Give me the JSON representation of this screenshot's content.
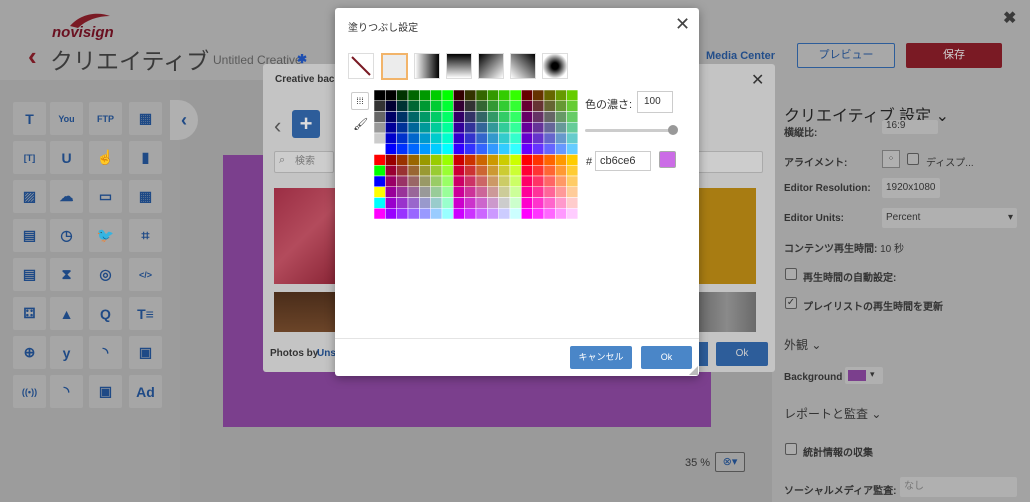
{
  "header": {
    "logo_text": "novisign",
    "title": "クリエイティブ",
    "creative_name": "Untitled Creative",
    "unsaved_marker": "✱",
    "media_center": "Media Center",
    "preview_label": "プレビュー",
    "save_label": "保存"
  },
  "toolbar": {
    "collapse_icon": "chevron-left-icon",
    "tools": [
      {
        "icon": "text-icon",
        "glyph": "T"
      },
      {
        "icon": "youtube-icon",
        "glyph": "You"
      },
      {
        "icon": "ftp-icon",
        "glyph": "FTP"
      },
      {
        "icon": "calendar-icon",
        "glyph": "▦"
      },
      {
        "icon": "text-box-icon",
        "glyph": "[T]"
      },
      {
        "icon": "u-icon",
        "glyph": "U"
      },
      {
        "icon": "touch-icon",
        "glyph": "☝"
      },
      {
        "icon": "bar-chart-icon",
        "glyph": "▮"
      },
      {
        "icon": "image-icon",
        "glyph": "▨"
      },
      {
        "icon": "weather-icon",
        "glyph": "☁"
      },
      {
        "icon": "monitor-icon",
        "glyph": "▭"
      },
      {
        "icon": "table-icon",
        "glyph": "▦"
      },
      {
        "icon": "film-icon",
        "glyph": "▤"
      },
      {
        "icon": "clock-icon",
        "glyph": "◷"
      },
      {
        "icon": "twitter-icon",
        "glyph": "🐦"
      },
      {
        "icon": "qr-icon",
        "glyph": "⌗"
      },
      {
        "icon": "document-icon",
        "glyph": "▤"
      },
      {
        "icon": "hourglass-icon",
        "glyph": "⧗"
      },
      {
        "icon": "instagram-icon",
        "glyph": "◎"
      },
      {
        "icon": "code-icon",
        "glyph": "</>"
      },
      {
        "icon": "dice-icon",
        "glyph": "⚃"
      },
      {
        "icon": "shapes-icon",
        "glyph": "▲"
      },
      {
        "icon": "q-icon",
        "glyph": "Q"
      },
      {
        "icon": "text-list-icon",
        "glyph": "T≡"
      },
      {
        "icon": "globe-icon",
        "glyph": "⊕"
      },
      {
        "icon": "yammer-icon",
        "glyph": "y"
      },
      {
        "icon": "rss-icon",
        "glyph": "◝"
      },
      {
        "icon": "image-list-icon",
        "glyph": "▣"
      },
      {
        "icon": "broadcast-icon",
        "glyph": "((•))"
      },
      {
        "icon": "rss-alt-icon",
        "glyph": "◝"
      },
      {
        "icon": "gallery-icon",
        "glyph": "▣"
      },
      {
        "icon": "ad-icon",
        "glyph": "Ad"
      }
    ]
  },
  "canvas": {
    "zoom": "35 %",
    "zoom_icon": "zoom-icon"
  },
  "background_dialog": {
    "title": "Creative back",
    "search_placeholder": "検索",
    "photos_by": "Photos by",
    "photos_link": "Uns",
    "ok_label": "Ok"
  },
  "fill_dialog": {
    "title": "塗りつぶし設定",
    "fill_types": [
      "none",
      "solid",
      "linear-h",
      "linear-v",
      "linear-diag",
      "linear-diag2",
      "radial"
    ],
    "opacity_label": "色の濃さ:",
    "opacity_value": "100",
    "hash": "#",
    "hex_value": "cb6ce6",
    "selected_color": "#cb6ce6",
    "cancel_label": "キャンセル",
    "ok_label": "Ok"
  },
  "right_panel": {
    "heading": "クリエイティブ 設定",
    "partial_label": "横縦比:",
    "partial_value": "16:9",
    "alignment_label": "アライメント:",
    "display_label": "ディスプ...",
    "editor_resolution_label": "Editor Resolution:",
    "editor_resolution_value": "1920x1080",
    "editor_units_label": "Editor Units:",
    "editor_units_value": "Percent",
    "content_duration_label": "コンテンツ再生時間:",
    "content_duration_value": "10 秒",
    "auto_duration_label": "再生時間の自動設定:",
    "update_playlist_label": "プレイリストの再生時間を更新",
    "appearance_label": "外観",
    "background_label": "Background",
    "background_color": "#7b3f8d",
    "report_label": "レポートと監査",
    "stats_label": "統計情報の収集",
    "social_label": "ソーシャルメディア監査:",
    "social_value": "なし"
  }
}
